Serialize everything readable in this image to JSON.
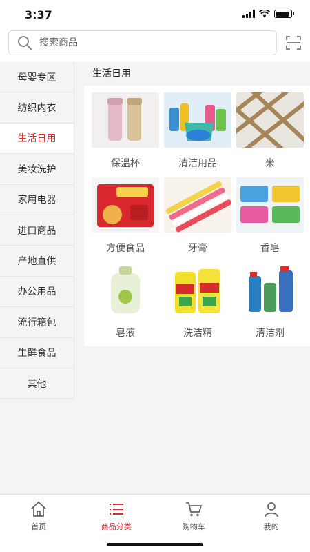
{
  "status": {
    "time": "3:37",
    "battery_level": 0.9
  },
  "search": {
    "placeholder": "搜索商品"
  },
  "sidebar": {
    "items": [
      {
        "label": "母婴专区"
      },
      {
        "label": "纺织内衣"
      },
      {
        "label": "生活日用",
        "active": true
      },
      {
        "label": "美妆洗护"
      },
      {
        "label": "家用电器"
      },
      {
        "label": "进口商品"
      },
      {
        "label": "产地直供"
      },
      {
        "label": "办公用品"
      },
      {
        "label": "流行箱包"
      },
      {
        "label": "生鲜食品"
      },
      {
        "label": "其他"
      }
    ]
  },
  "main": {
    "category_title": "生活日用",
    "products": [
      {
        "name": "保温杯",
        "icon": "thermos-image"
      },
      {
        "name": "清洁用品",
        "icon": "cleaning-supplies-image"
      },
      {
        "name": "米",
        "icon": "rice-image"
      },
      {
        "name": "方便食品",
        "icon": "instant-noodles-image"
      },
      {
        "name": "牙膏",
        "icon": "toothpaste-image"
      },
      {
        "name": "香皂",
        "icon": "soap-image"
      },
      {
        "name": "皂液",
        "icon": "liquid-soap-image"
      },
      {
        "name": "洗洁精",
        "icon": "dish-detergent-image"
      },
      {
        "name": "清洁剂",
        "icon": "cleaner-image"
      }
    ]
  },
  "tabbar": {
    "tabs": [
      {
        "label": "首页",
        "icon": "home-icon"
      },
      {
        "label": "商品分类",
        "icon": "category-list-icon",
        "active": true
      },
      {
        "label": "购物车",
        "icon": "cart-icon"
      },
      {
        "label": "我的",
        "icon": "user-icon"
      }
    ]
  },
  "colors": {
    "accent": "#d9302b",
    "active_bg": "#ffffff",
    "page_bg": "#f4f4f4"
  }
}
